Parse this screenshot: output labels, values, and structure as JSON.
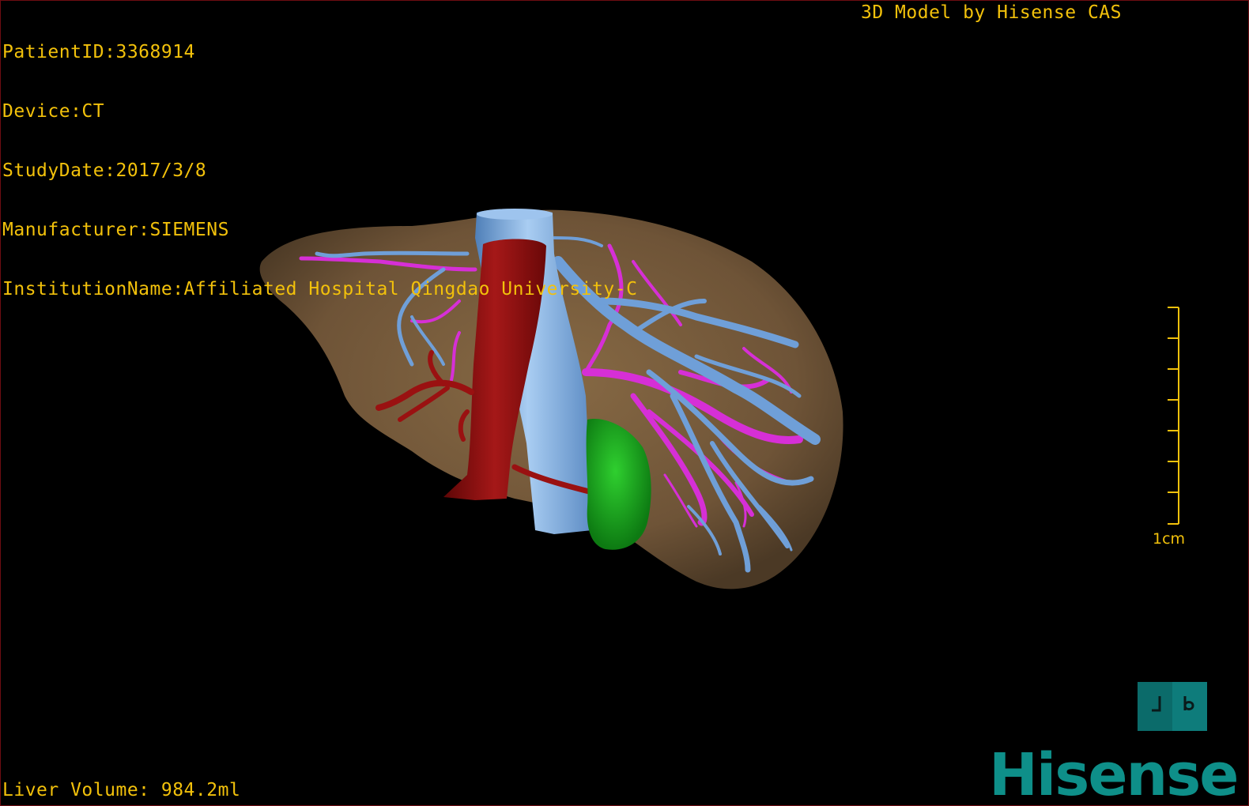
{
  "overlay": {
    "patient_id": "PatientID:3368914",
    "device": "Device:CT",
    "study_date": "StudyDate:2017/3/8",
    "manufacturer": "Manufacturer:SIEMENS",
    "institution": "InstitutionName:Affiliated Hospital Qingdao University-C",
    "credit": "3D Model by Hisense CAS",
    "liver_volume": "Liver Volume: 984.2ml"
  },
  "scale": {
    "label": "1cm"
  },
  "orientation_cube": {
    "glyph_left": "ꟷ",
    "glyph_right": "d"
  },
  "brand": {
    "logo_text": "Hisense"
  },
  "colors": {
    "overlay_text": "#f2c10b",
    "liver": "#7a5f3f",
    "portal_vein": "#6f9fd8",
    "hepatic_vein": "#d62fd6",
    "aorta": "#8d0d0d",
    "tumor": "#19a51f",
    "brand": "#0e8f89"
  }
}
